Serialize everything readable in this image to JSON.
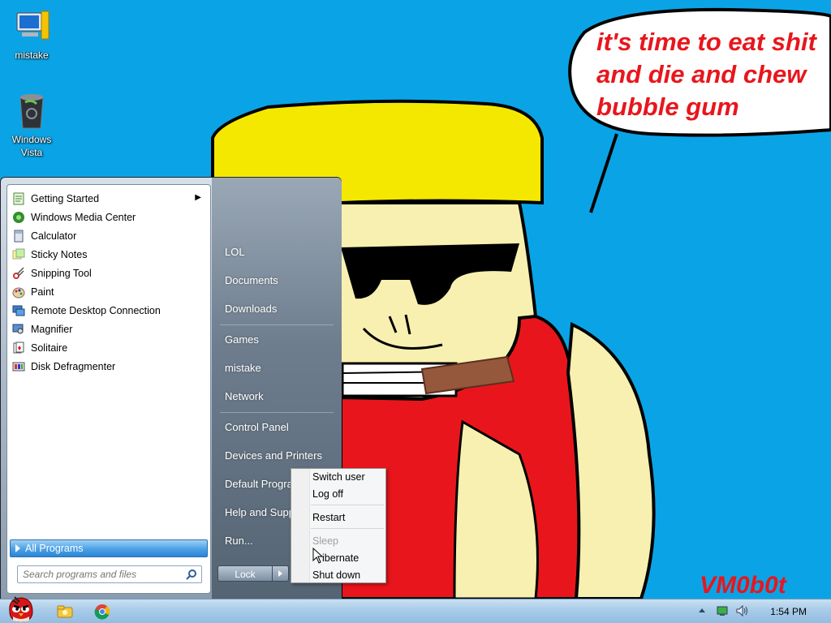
{
  "desktop": {
    "icons": [
      {
        "label": "mistake",
        "icon": "computer-icon"
      },
      {
        "label": "Windows\nVista",
        "icon": "recycle-bin-icon"
      }
    ],
    "wallpaper": {
      "speech_text": [
        "it's time to eat shit",
        "and die and chew",
        "bubble gum"
      ],
      "signature": "VM0b0t",
      "colors": {
        "sky": "#0aa4e6",
        "hair": "#f5e800",
        "skin": "#f7f0b0",
        "shirt": "#e8161c",
        "text": "#e8161c"
      }
    }
  },
  "start_menu": {
    "programs": [
      {
        "label": "Getting Started",
        "icon": "getting-started-icon",
        "submenu": true
      },
      {
        "label": "Windows Media Center",
        "icon": "media-center-icon"
      },
      {
        "label": "Calculator",
        "icon": "calculator-icon"
      },
      {
        "label": "Sticky Notes",
        "icon": "sticky-notes-icon"
      },
      {
        "label": "Snipping Tool",
        "icon": "snipping-tool-icon"
      },
      {
        "label": "Paint",
        "icon": "paint-icon"
      },
      {
        "label": "Remote Desktop Connection",
        "icon": "remote-desktop-icon"
      },
      {
        "label": "Magnifier",
        "icon": "magnifier-icon"
      },
      {
        "label": "Solitaire",
        "icon": "solitaire-icon"
      },
      {
        "label": "Disk Defragmenter",
        "icon": "disk-defragmenter-icon"
      }
    ],
    "all_programs": "All Programs",
    "search_placeholder": "Search programs and files",
    "places": [
      "LOL",
      "Documents",
      "Downloads",
      "Games",
      "mistake",
      "Network",
      "Control Panel",
      "Devices and Printers",
      "Default Progra",
      "Help and Supp",
      "Run..."
    ],
    "lock_label": "Lock"
  },
  "power_menu": {
    "items": [
      {
        "label": "Switch user",
        "enabled": true
      },
      {
        "label": "Log off",
        "enabled": true
      },
      {
        "label": "Restart",
        "enabled": true
      },
      {
        "label": "Sleep",
        "enabled": false
      },
      {
        "label": "ibernate",
        "enabled": true
      },
      {
        "label": "Shut down",
        "enabled": true
      }
    ]
  },
  "taskbar": {
    "clock": "1:54 PM",
    "pinned": [
      "start-orb-icon",
      "explorer-icon",
      "chrome-icon"
    ],
    "tray": [
      "show-hidden-icon",
      "network-icon",
      "volume-icon"
    ]
  }
}
